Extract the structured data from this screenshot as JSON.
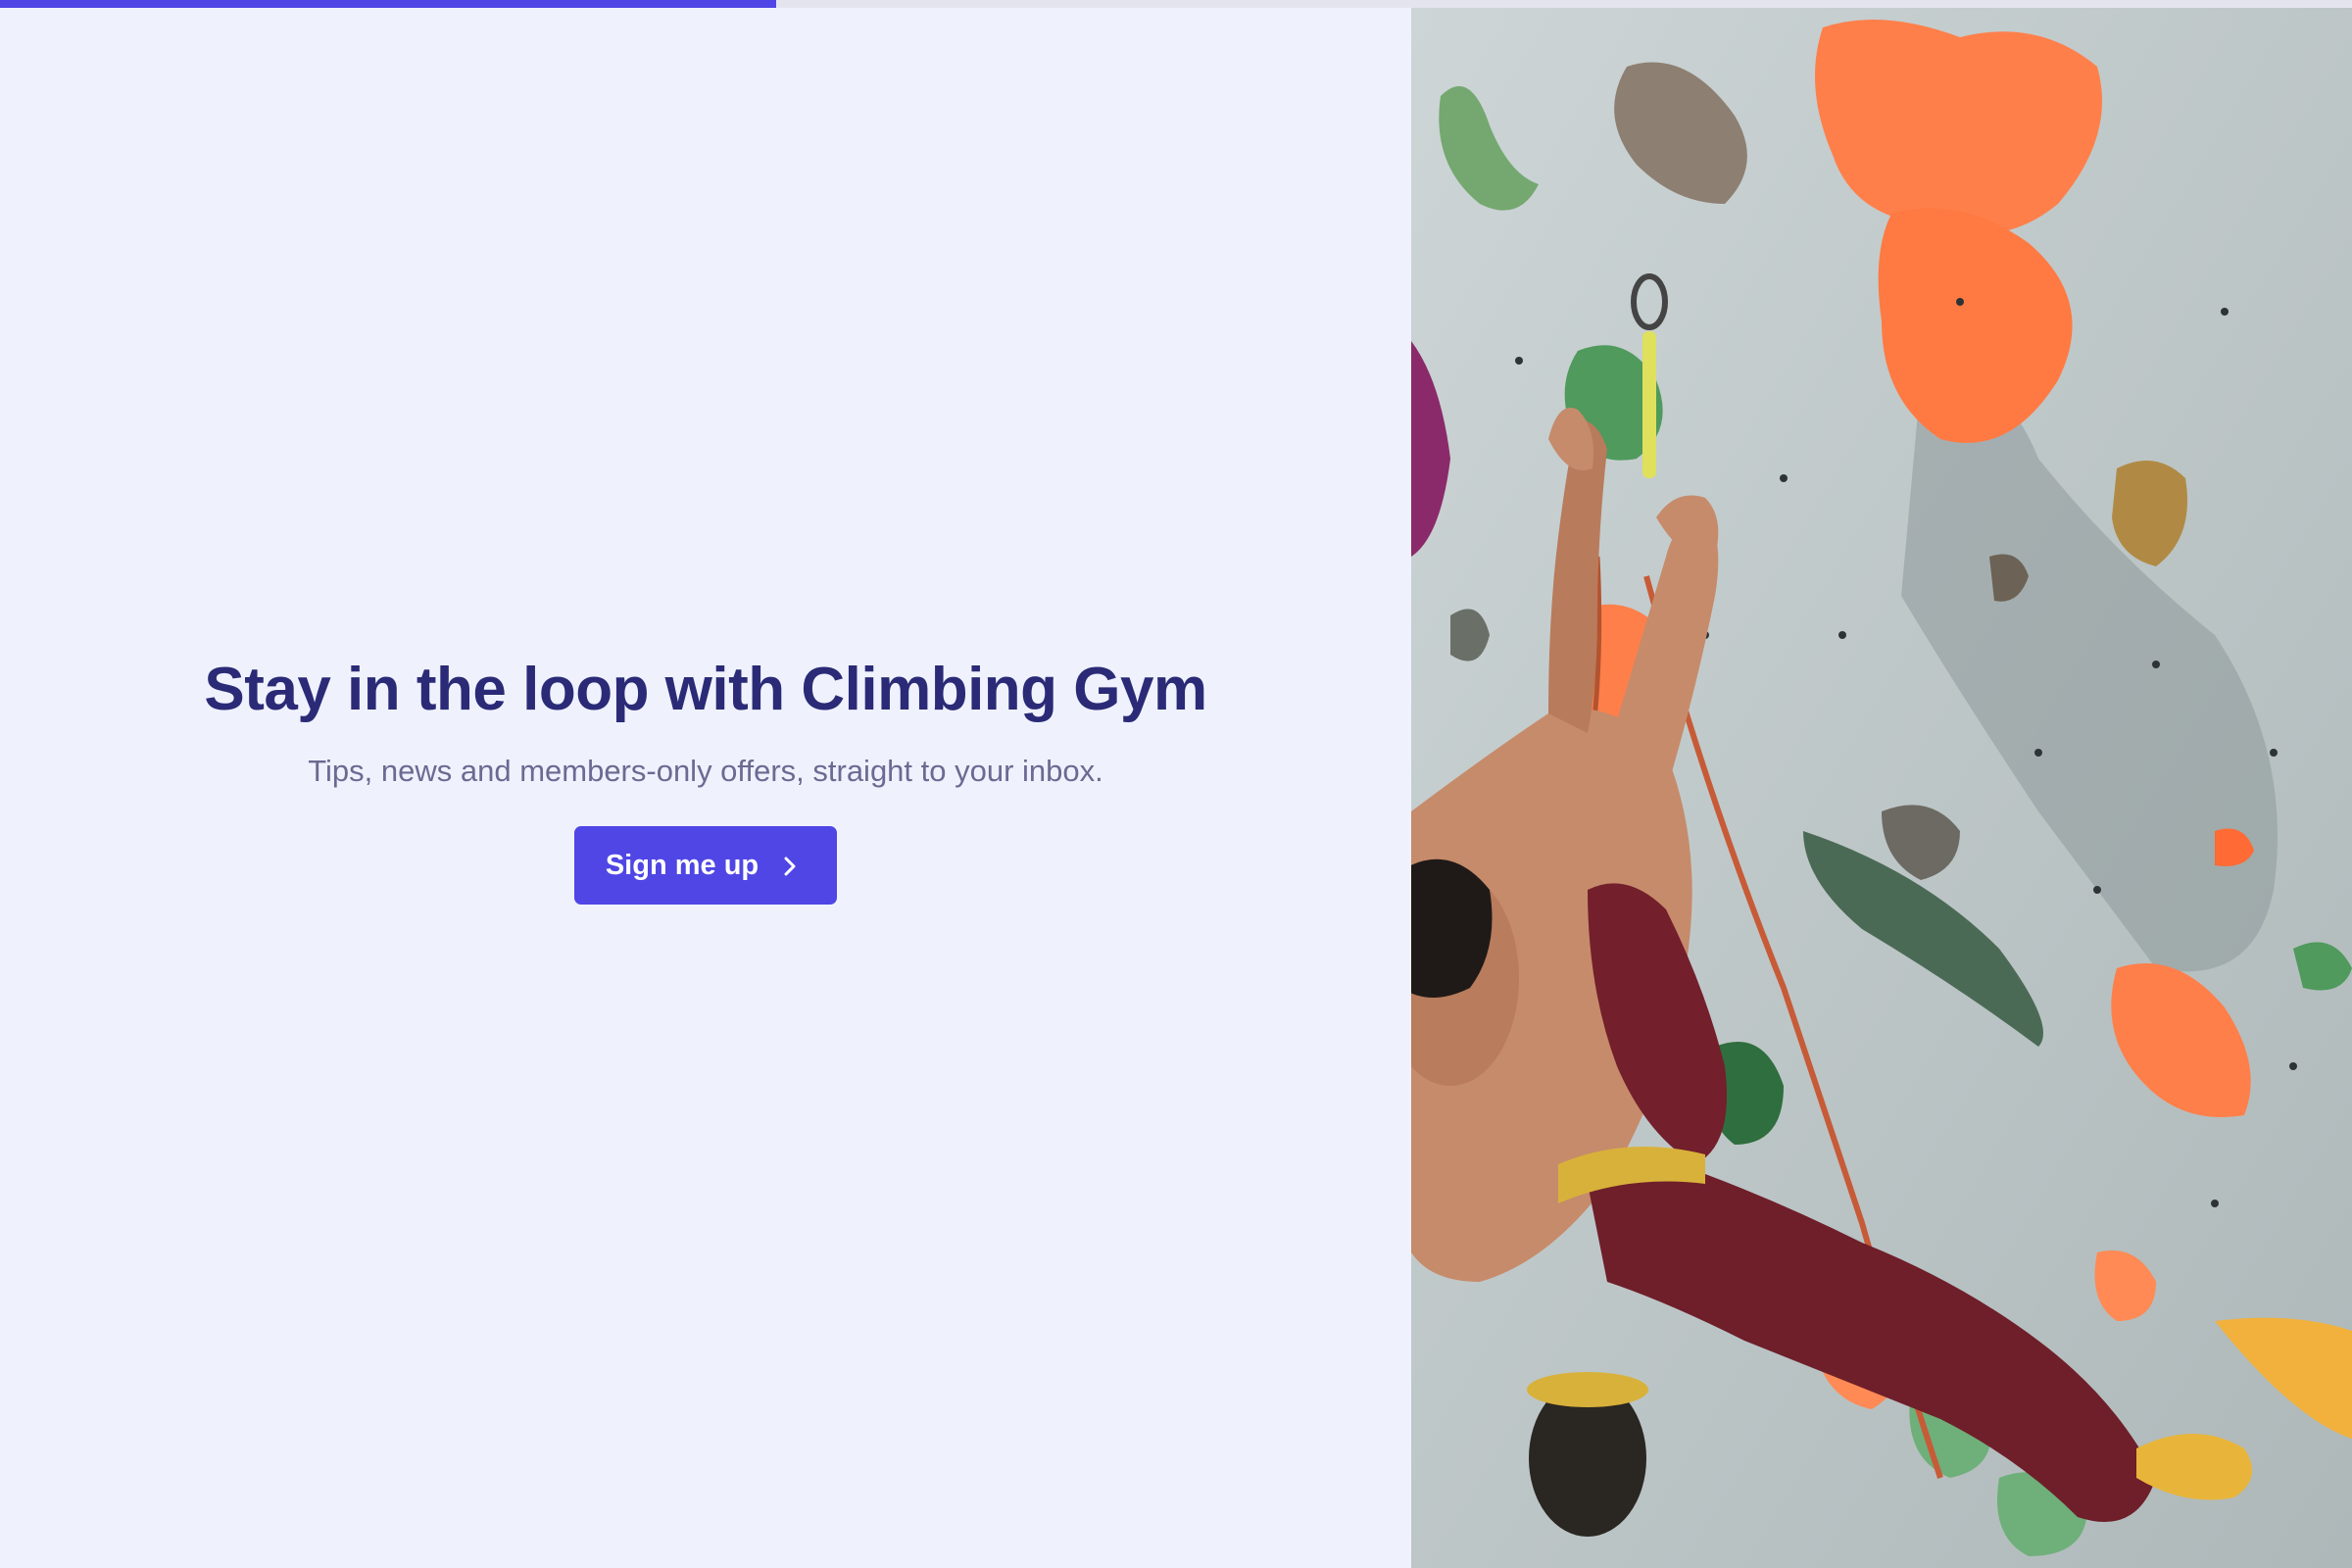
{
  "progress": {
    "value_percent": 33,
    "color": "#4f46e5"
  },
  "hero": {
    "headline": "Stay in the loop with Climbing Gym",
    "subtitle": "Tips, news and members-only offers, straight to your inbox.",
    "cta_label": "Sign me up",
    "cta_icon": "chevron-right-icon"
  },
  "image": {
    "subject": "climber-on-indoor-wall",
    "colors": {
      "wall": "#c3cccc",
      "hold_orange": "#ff7f4a",
      "hold_green": "#5ea66a",
      "hold_purple": "#8a2a6a",
      "pants": "#6e1f2a",
      "skin": "#c48a6a"
    }
  }
}
